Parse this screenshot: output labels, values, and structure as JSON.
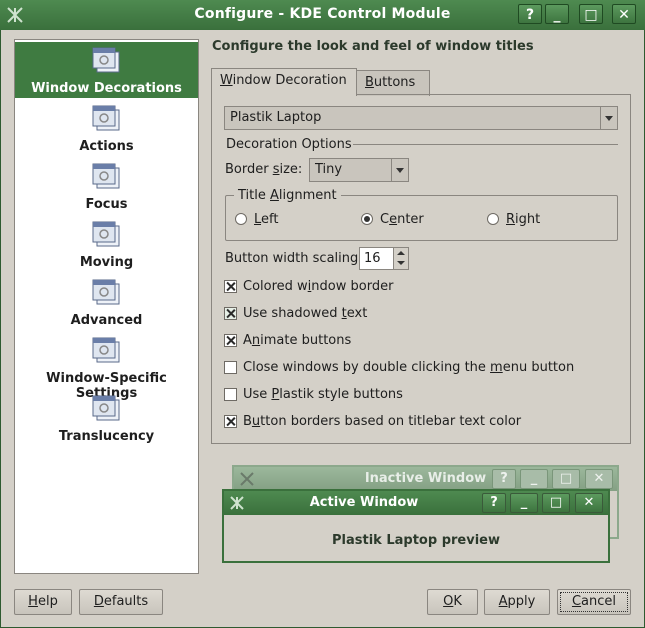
{
  "window": {
    "title": "Configure - KDE Control Module",
    "controls": {
      "help": "?",
      "minimize": "_",
      "maximize": "□",
      "close": "✕"
    }
  },
  "sidebar": {
    "items": [
      {
        "label": "Window Decorations",
        "selected": true
      },
      {
        "label": "Actions",
        "selected": false
      },
      {
        "label": "Focus",
        "selected": false
      },
      {
        "label": "Moving",
        "selected": false
      },
      {
        "label": "Advanced",
        "selected": false
      },
      {
        "label": "Window-Specific Settings",
        "selected": false
      },
      {
        "label": "Translucency",
        "selected": false
      }
    ]
  },
  "main": {
    "heading": "Configure the look and feel of window titles",
    "tabs": [
      {
        "label": "Window Decoration",
        "mnemonic": "W",
        "rest": "indow Decoration",
        "active": true
      },
      {
        "label": "Buttons",
        "mnemonic": "B",
        "rest": "uttons",
        "active": false
      }
    ],
    "decoration_combo": {
      "value": "Plastik Laptop"
    },
    "decoration_options": {
      "heading": "Decoration Options",
      "border_size_label_pre": "Border ",
      "border_size_label_mn": "s",
      "border_size_label_post": "ize:",
      "border_size_value": "Tiny"
    },
    "title_alignment": {
      "heading_pre": "Title ",
      "heading_mn": "A",
      "heading_post": "lignment",
      "options": [
        {
          "label": "Left",
          "mn": "L",
          "rest": "eft",
          "selected": false
        },
        {
          "label": "Center",
          "pre": "C",
          "mn": "e",
          "rest": "nter",
          "selected": true
        },
        {
          "label": "Right",
          "mn": "R",
          "rest": "ight",
          "selected": false
        }
      ]
    },
    "button_width": {
      "label": "Button width scaling",
      "value": "16"
    },
    "checkboxes": [
      {
        "pre": "Colored w",
        "mn": "i",
        "post": "ndow border",
        "checked": true
      },
      {
        "pre": "Use shadowed ",
        "mn": "t",
        "post": "ext",
        "checked": true
      },
      {
        "pre": "A",
        "mn": "n",
        "post": "imate buttons",
        "checked": true,
        "mn_first": false
      },
      {
        "pre": "Close windows by double clicking the ",
        "mn": "m",
        "post": "enu button",
        "checked": false
      },
      {
        "pre": "Use ",
        "mn": "P",
        "post": "lastik style buttons",
        "checked": false
      },
      {
        "pre": "B",
        "mn": "u",
        "post": "tton borders based on titlebar text color",
        "checked": true
      }
    ],
    "preview": {
      "inactive_title": "Inactive Window",
      "active_title": "Active Window",
      "caption": "Plastik Laptop preview"
    }
  },
  "footer": {
    "help": {
      "mn": "H",
      "rest": "elp"
    },
    "defaults": {
      "mn": "D",
      "rest": "efaults"
    },
    "ok": {
      "mn": "O",
      "rest": "K"
    },
    "apply": {
      "mn": "A",
      "rest": "pply"
    },
    "cancel": {
      "mn": "C",
      "rest": "ancel"
    }
  },
  "colors": {
    "accent": "#3f7b41",
    "titlebar_active": "#3a703c",
    "titlebar_inactive": "#8ca88c"
  }
}
